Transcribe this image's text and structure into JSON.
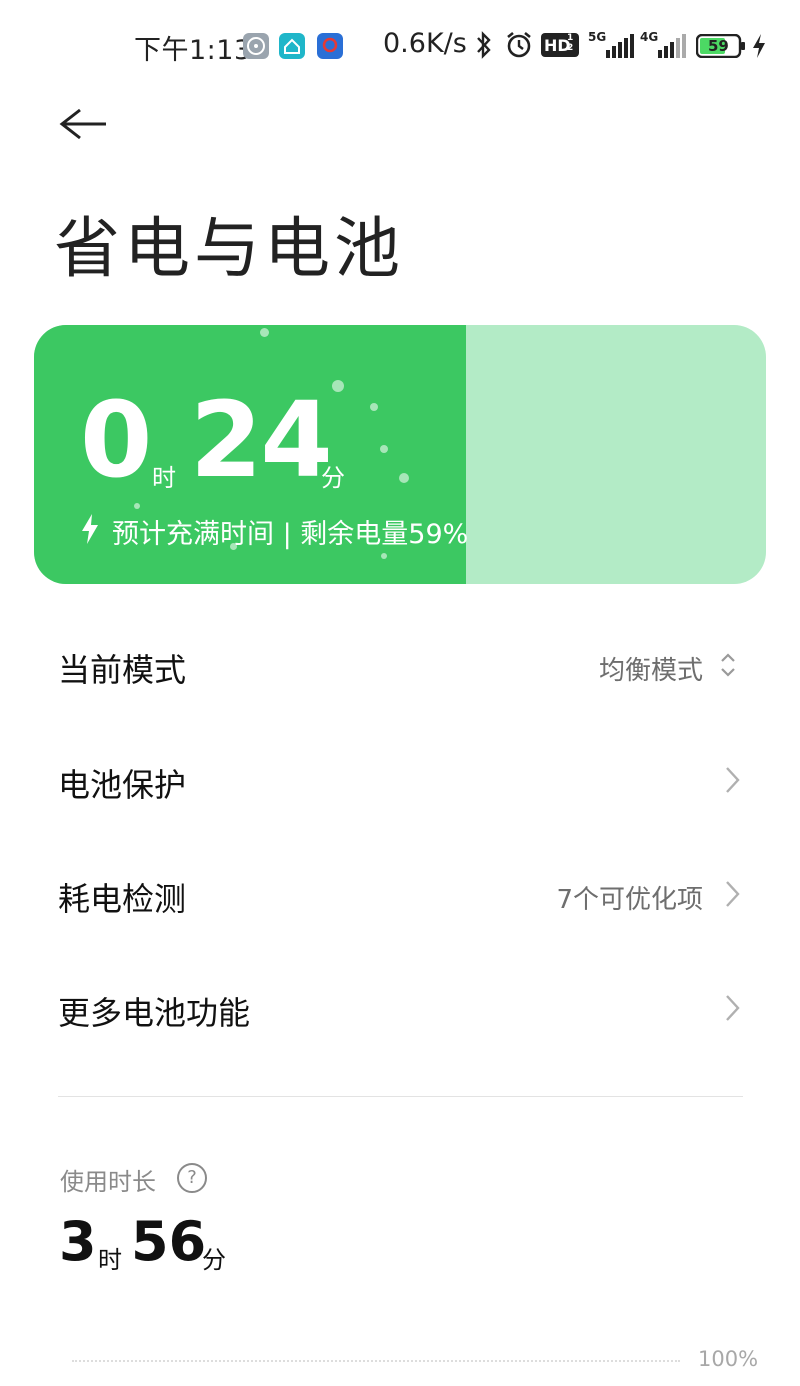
{
  "status_bar": {
    "time": "下午1:13",
    "app_icons": [
      "steering-wheel-app-icon",
      "home-app-icon",
      "shield-app-icon"
    ],
    "network_speed": "0.6K/s",
    "hd_label": "HD",
    "hd_sub": "1 2",
    "signal1_label": "5G",
    "signal2_label": "4G",
    "battery_level": "59",
    "colors": {
      "battery_fill": "#4cd964"
    }
  },
  "page": {
    "title": "省电与电池"
  },
  "battery_card": {
    "hours": "0",
    "hours_unit": "时",
    "minutes": "24",
    "minutes_unit": "分",
    "subtitle": "预计充满时间 | 剩余电量59%",
    "charge_level": 0.59,
    "colors": {
      "fill": "#3cc862",
      "track": "#b3ebc6"
    }
  },
  "settings": [
    {
      "label": "当前模式",
      "value": "均衡模式",
      "control": "up-down-chevron-icon"
    },
    {
      "label": "电池保护",
      "value": "",
      "control": "chevron-right-icon"
    },
    {
      "label": "耗电检测",
      "value": "7个可优化项",
      "control": "chevron-right-icon"
    },
    {
      "label": "更多电池功能",
      "value": "",
      "control": "chevron-right-icon"
    }
  ],
  "usage": {
    "label": "使用时长",
    "help": "?",
    "hours": "3",
    "hours_unit": "时",
    "minutes": "56",
    "minutes_unit": "分"
  },
  "chart": {
    "top_label": "100%"
  }
}
